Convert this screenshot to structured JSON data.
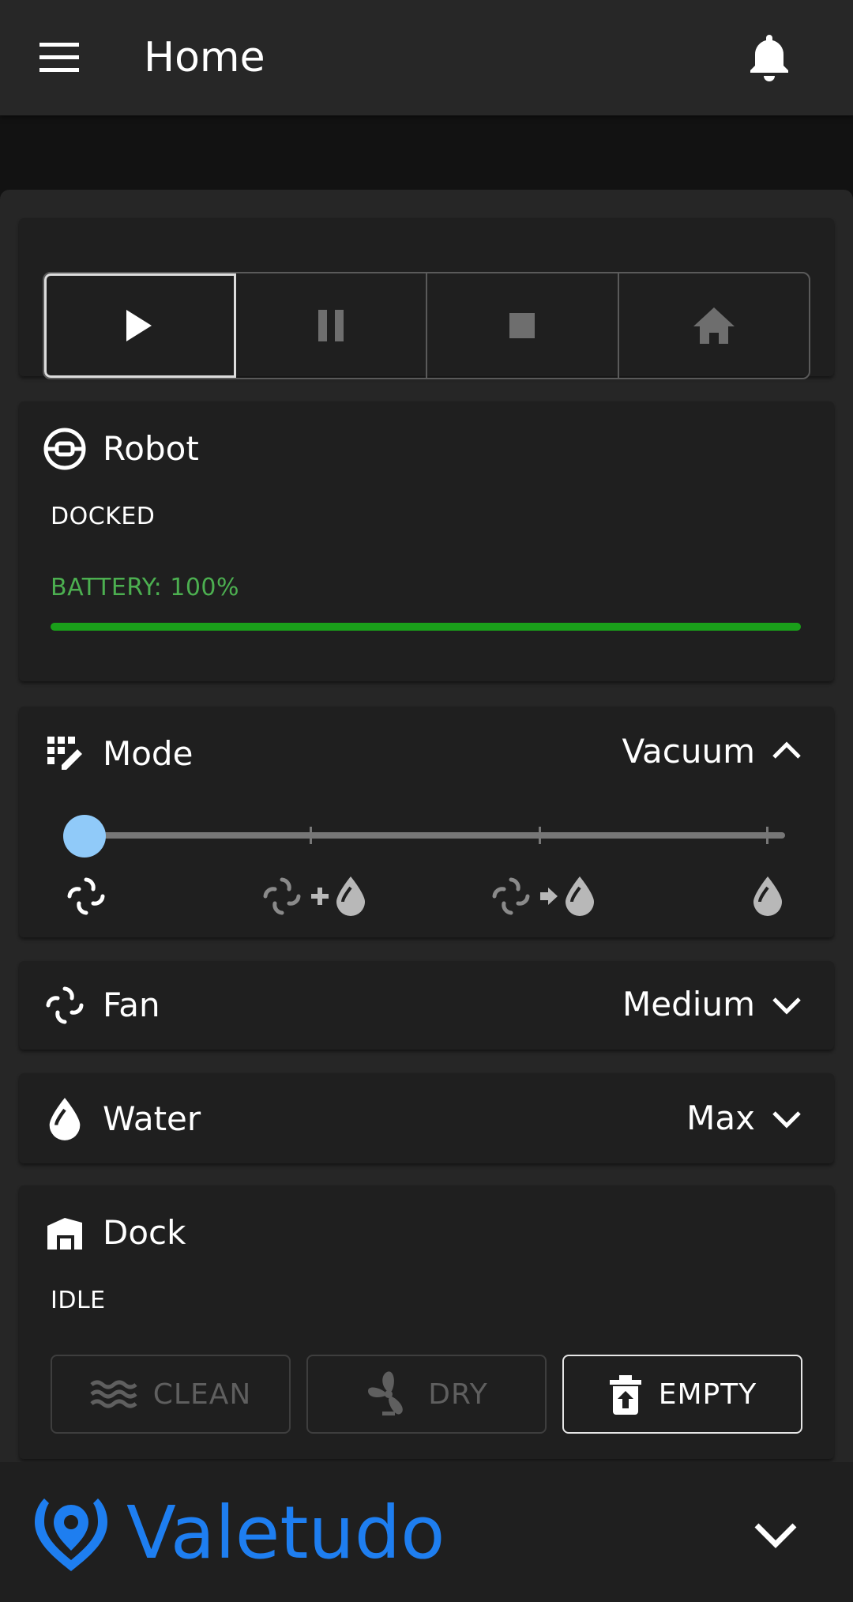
{
  "appbar": {
    "title": "Home"
  },
  "controls": {
    "buttons": [
      "play",
      "pause",
      "stop",
      "home"
    ],
    "active": "play"
  },
  "robot": {
    "title": "Robot",
    "status": "DOCKED",
    "battery_label": "BATTERY: 100%",
    "battery_level": 100
  },
  "mode": {
    "title": "Mode",
    "value": "Vacuum",
    "slider_index": 0,
    "marks": [
      "vacuum",
      "vacuum-and-mop",
      "vacuum-then-mop",
      "mop"
    ]
  },
  "fan": {
    "title": "Fan",
    "value": "Medium"
  },
  "water": {
    "title": "Water",
    "value": "Max"
  },
  "dock": {
    "title": "Dock",
    "status": "IDLE",
    "clean_label": "CLEAN",
    "dry_label": "DRY",
    "empty_label": "EMPTY"
  },
  "footer": {
    "brand": "Valetudo"
  },
  "colors": {
    "accent": "#1e7ef0",
    "battery": "#4caf50",
    "slider_thumb": "#90caf9"
  }
}
